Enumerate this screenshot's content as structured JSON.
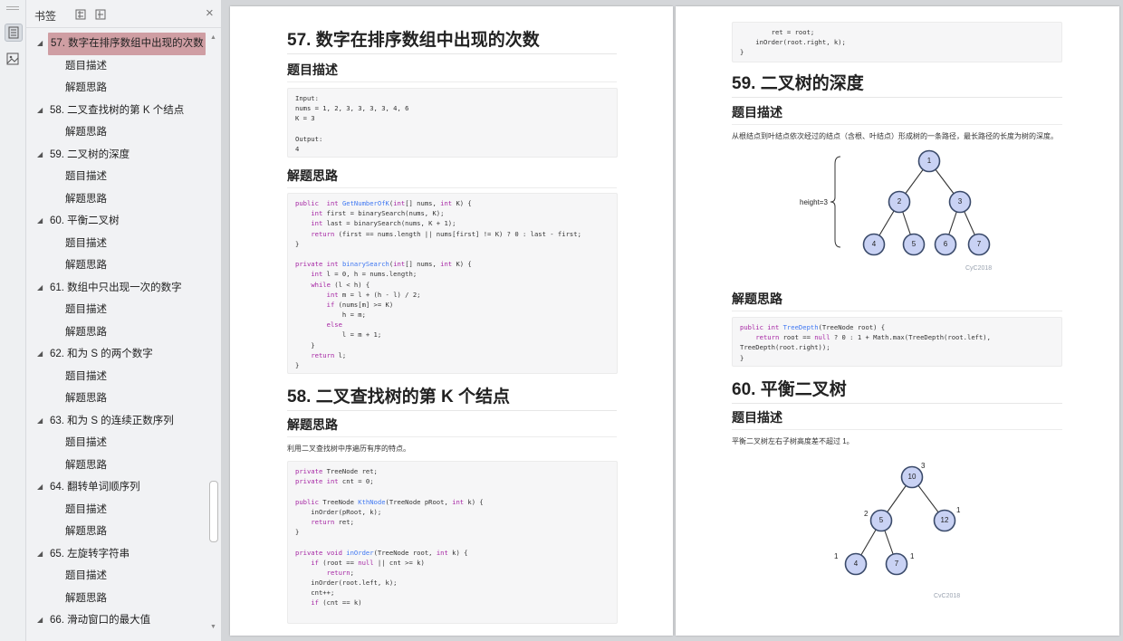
{
  "sidebar": {
    "title": "书签",
    "close_glyph": "×",
    "items": [
      {
        "label": "57. 数字在排序数组中出现的次数",
        "level": 1,
        "selected": true
      },
      {
        "label": "题目描述",
        "level": 2
      },
      {
        "label": "解题思路",
        "level": 2
      },
      {
        "label": "58. 二叉查找树的第 K 个结点",
        "level": 1
      },
      {
        "label": "解题思路",
        "level": 2
      },
      {
        "label": "59. 二叉树的深度",
        "level": 1
      },
      {
        "label": "题目描述",
        "level": 2
      },
      {
        "label": "解题思路",
        "level": 2
      },
      {
        "label": "60. 平衡二叉树",
        "level": 1
      },
      {
        "label": "题目描述",
        "level": 2
      },
      {
        "label": "解题思路",
        "level": 2
      },
      {
        "label": "61. 数组中只出现一次的数字",
        "level": 1
      },
      {
        "label": "题目描述",
        "level": 2
      },
      {
        "label": "解题思路",
        "level": 2
      },
      {
        "label": "62. 和为 S 的两个数字",
        "level": 1
      },
      {
        "label": "题目描述",
        "level": 2
      },
      {
        "label": "解题思路",
        "level": 2
      },
      {
        "label": "63. 和为 S 的连续正数序列",
        "level": 1
      },
      {
        "label": "题目描述",
        "level": 2
      },
      {
        "label": "解题思路",
        "level": 2
      },
      {
        "label": "64. 翻转单词顺序列",
        "level": 1
      },
      {
        "label": "题目描述",
        "level": 2
      },
      {
        "label": "解题思路",
        "level": 2
      },
      {
        "label": "65. 左旋转字符串",
        "level": 1
      },
      {
        "label": "题目描述",
        "level": 2
      },
      {
        "label": "解题思路",
        "level": 2
      },
      {
        "label": "66. 滑动窗口的最大值",
        "level": 1
      }
    ]
  },
  "left_page": {
    "s57_title": "57. 数字在排序数组中出现的次数",
    "s57_desc_heading": "题目描述",
    "s57_example": [
      "Input:",
      "nums = 1, 2, 3, 3, 3, 3, 4, 6",
      "K = 3",
      "",
      "Output:",
      "4"
    ],
    "s57_solution_heading": "解题思路",
    "s57_code": [
      [
        [
          "kw",
          "public"
        ],
        [
          "",
          "  "
        ],
        [
          "kw",
          "int"
        ],
        [
          "",
          " "
        ],
        [
          "fn",
          "GetNumberOfK"
        ],
        [
          "",
          "("
        ],
        [
          "kw",
          "int"
        ],
        [
          "",
          "[] nums, "
        ],
        [
          "kw",
          "int"
        ],
        [
          "",
          " K) {"
        ]
      ],
      [
        [
          "",
          "    "
        ],
        [
          "kw",
          "int"
        ],
        [
          "",
          " first = binarySearch(nums, K);"
        ]
      ],
      [
        [
          "",
          "    "
        ],
        [
          "kw",
          "int"
        ],
        [
          "",
          " last = binarySearch(nums, K + 1);"
        ]
      ],
      [
        [
          "",
          "    "
        ],
        [
          "kw",
          "return"
        ],
        [
          "",
          " (first == nums.length || nums[first] != K) ? 0 : last - first;"
        ]
      ],
      [
        [
          "",
          "}"
        ]
      ],
      [],
      [
        [
          "kw",
          "private"
        ],
        [
          "",
          " "
        ],
        [
          "kw",
          "int"
        ],
        [
          "",
          " "
        ],
        [
          "fn",
          "binarySearch"
        ],
        [
          "",
          "("
        ],
        [
          "kw",
          "int"
        ],
        [
          "",
          "[] nums, "
        ],
        [
          "kw",
          "int"
        ],
        [
          "",
          " K) {"
        ]
      ],
      [
        [
          "",
          "    "
        ],
        [
          "kw",
          "int"
        ],
        [
          "",
          " l = 0, h = nums.length;"
        ]
      ],
      [
        [
          "",
          "    "
        ],
        [
          "kw",
          "while"
        ],
        [
          "",
          " (l < h) {"
        ]
      ],
      [
        [
          "",
          "        "
        ],
        [
          "kw",
          "int"
        ],
        [
          "",
          " m = l + (h - l) / 2;"
        ]
      ],
      [
        [
          "",
          "        "
        ],
        [
          "kw",
          "if"
        ],
        [
          "",
          " (nums[m] >= K)"
        ]
      ],
      [
        [
          "",
          "            h = m;"
        ]
      ],
      [
        [
          "",
          "        "
        ],
        [
          "kw",
          "else"
        ]
      ],
      [
        [
          "",
          "            l = m + 1;"
        ]
      ],
      [
        [
          "",
          "    }"
        ]
      ],
      [
        [
          "",
          "    "
        ],
        [
          "kw",
          "return"
        ],
        [
          "",
          " l;"
        ]
      ],
      [
        [
          "",
          "}"
        ]
      ]
    ],
    "s58_title": "58. 二叉查找树的第 K 个结点",
    "s58_solution_heading": "解题思路",
    "s58_text": "利用二叉查找树中序遍历有序的特点。",
    "s58_code": [
      [
        [
          "kw",
          "private"
        ],
        [
          "",
          " TreeNode ret;"
        ]
      ],
      [
        [
          "kw",
          "private"
        ],
        [
          "",
          " "
        ],
        [
          "kw",
          "int"
        ],
        [
          "",
          " cnt = 0;"
        ]
      ],
      [],
      [
        [
          "kw",
          "public"
        ],
        [
          "",
          " TreeNode "
        ],
        [
          "fn",
          "KthNode"
        ],
        [
          "",
          "(TreeNode pRoot, "
        ],
        [
          "kw",
          "int"
        ],
        [
          "",
          " k) {"
        ]
      ],
      [
        [
          "",
          "    inOrder(pRoot, k);"
        ]
      ],
      [
        [
          "",
          "    "
        ],
        [
          "kw",
          "return"
        ],
        [
          "",
          " ret;"
        ]
      ],
      [
        [
          "",
          "}"
        ]
      ],
      [],
      [
        [
          "kw",
          "private"
        ],
        [
          "",
          " "
        ],
        [
          "kw",
          "void"
        ],
        [
          "",
          " "
        ],
        [
          "fn",
          "inOrder"
        ],
        [
          "",
          "(TreeNode root, "
        ],
        [
          "kw",
          "int"
        ],
        [
          "",
          " k) {"
        ]
      ],
      [
        [
          "",
          "    "
        ],
        [
          "kw",
          "if"
        ],
        [
          "",
          " (root == "
        ],
        [
          "kw",
          "null"
        ],
        [
          "",
          " || cnt >= k)"
        ]
      ],
      [
        [
          "",
          "        "
        ],
        [
          "kw",
          "return"
        ],
        [
          "",
          ";"
        ]
      ],
      [
        [
          "",
          "    inOrder(root.left, k);"
        ]
      ],
      [
        [
          "",
          "    cnt++;"
        ]
      ],
      [
        [
          "",
          "    "
        ],
        [
          "kw",
          "if"
        ],
        [
          "",
          " (cnt == k)"
        ]
      ]
    ]
  },
  "right_page": {
    "top_code": [
      [
        [
          "",
          "        ret = root;"
        ]
      ],
      [
        [
          "",
          "    inOrder(root.right, k);"
        ]
      ],
      [
        [
          "",
          "}"
        ]
      ]
    ],
    "s59_title": "59. 二叉树的深度",
    "s59_desc_heading": "题目描述",
    "s59_text": "从根结点到叶结点依次经过的结点（含根、叶结点）形成树的一条路径，最长路径的长度为树的深度。",
    "s59_height_label": "height=3",
    "s59_nodes": [
      "1",
      "2",
      "3",
      "4",
      "5",
      "6",
      "7"
    ],
    "watermark": "CyC2018",
    "s59_solution_heading": "解题思路",
    "s59_code": [
      [
        [
          "kw",
          "public"
        ],
        [
          "",
          " "
        ],
        [
          "kw",
          "int"
        ],
        [
          "",
          " "
        ],
        [
          "fn",
          "TreeDepth"
        ],
        [
          "",
          "(TreeNode root) {"
        ]
      ],
      [
        [
          "",
          "    "
        ],
        [
          "kw",
          "return"
        ],
        [
          "",
          " root == "
        ],
        [
          "kw",
          "null"
        ],
        [
          "",
          " ? 0 : 1 + Math.max(TreeDepth(root.left),"
        ]
      ],
      [
        [
          "",
          "TreeDepth(root.right));"
        ]
      ],
      [
        [
          "",
          "}"
        ]
      ]
    ],
    "s60_title": "60. 平衡二叉树",
    "s60_desc_heading": "题目描述",
    "s60_text": "平衡二叉树左右子树高度差不超过 1。",
    "s60_nodes": [
      "10",
      "5",
      "12",
      "4",
      "7"
    ],
    "s60_heights": [
      "3",
      "2",
      "1",
      "1",
      "1"
    ]
  }
}
